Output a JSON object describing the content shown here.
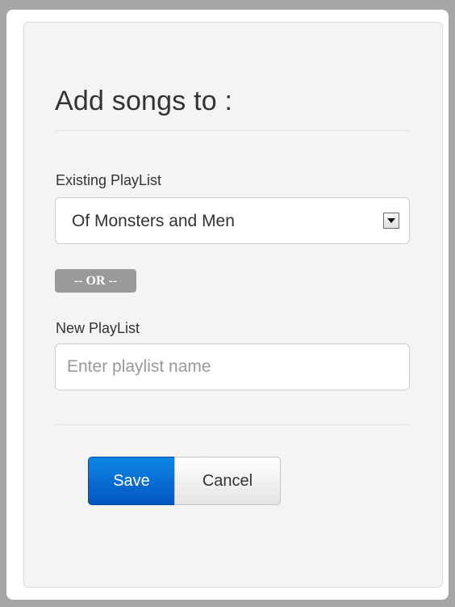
{
  "dialog": {
    "title": "Add songs to :"
  },
  "existing_playlist": {
    "label": "Existing PlayList",
    "selected_value": "Of Monsters and Men"
  },
  "separator": {
    "text": "-- OR --"
  },
  "new_playlist": {
    "label": "New PlayList",
    "value": "",
    "placeholder": "Enter playlist name"
  },
  "buttons": {
    "save_label": "Save",
    "cancel_label": "Cancel"
  },
  "colors": {
    "primary": "#0a6fd6",
    "badge": "#9a9a9a",
    "page_background": "#a6a6a6",
    "panel_background": "#f4f4f4"
  },
  "icons": {
    "select_arrow": "caret-down-icon"
  }
}
